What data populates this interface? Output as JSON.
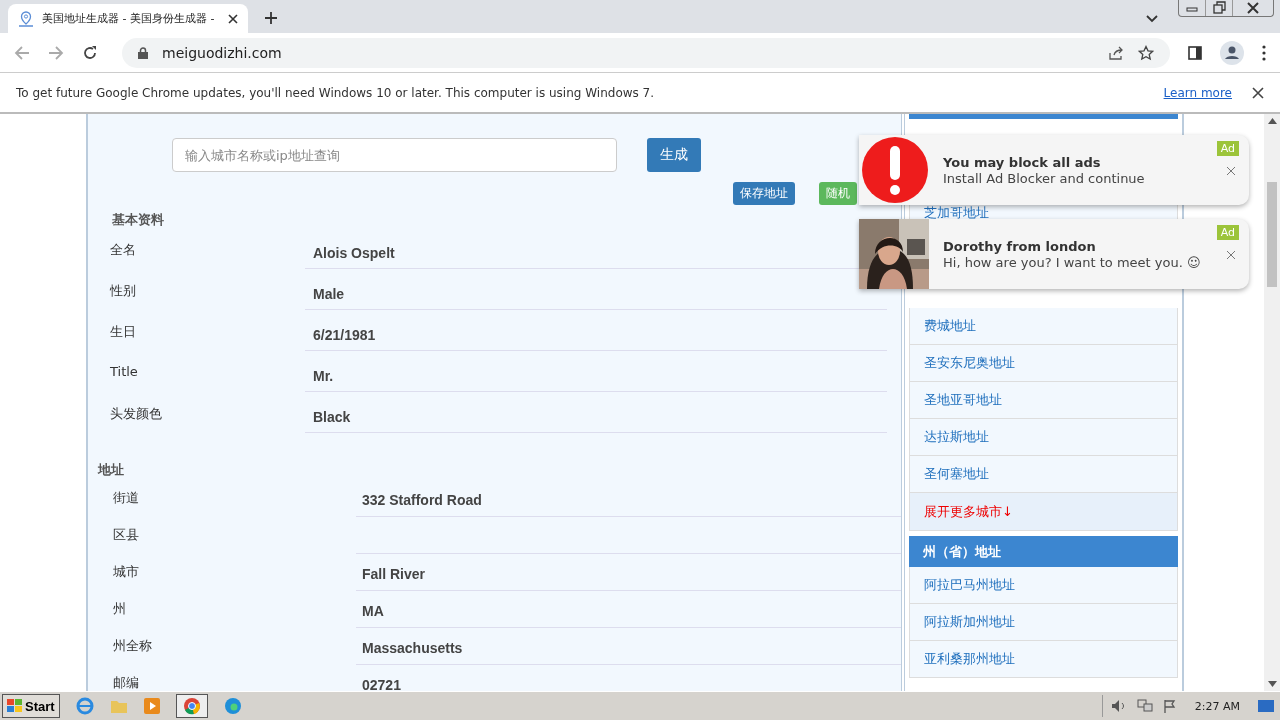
{
  "browser": {
    "tab_title": "美国地址生成器 - 美国身份生成器 -",
    "url": "meiguodizhi.com",
    "infobar": {
      "message": "To get future Google Chrome updates, you'll need Windows 10 or later. This computer is using Windows 7.",
      "link": "Learn more"
    }
  },
  "search": {
    "placeholder": "输入城市名称或ip地址查询",
    "button": "生成"
  },
  "actions": [
    {
      "label": "保存地址",
      "kind": "primary"
    },
    {
      "label": "随机",
      "kind": "success"
    }
  ],
  "basic": {
    "heading": "基本资料",
    "rows": [
      {
        "label": "全名",
        "value": "Alois Ospelt"
      },
      {
        "label": "性别",
        "value": "Male"
      },
      {
        "label": "生日",
        "value": "6/21/1981"
      },
      {
        "label": "Title",
        "value": "Mr."
      },
      {
        "label": "头发颜色",
        "value": "Black"
      }
    ]
  },
  "address": {
    "heading": "地址",
    "rows": [
      {
        "label": "街道",
        "value": "332 Stafford Road"
      },
      {
        "label": "区县"
      },
      {
        "label": "城市",
        "value": "Fall River"
      },
      {
        "label": "州",
        "value": "MA"
      },
      {
        "label": "州全称",
        "value": "Massachusetts"
      },
      {
        "label": "邮编",
        "value": "02721"
      }
    ]
  },
  "sidebar": {
    "cities": [
      {
        "label": "芝加哥地址",
        "kind": "link"
      },
      {
        "label": "费城地址",
        "kind": "link"
      },
      {
        "label": "圣安东尼奥地址",
        "kind": "link"
      },
      {
        "label": "圣地亚哥地址",
        "kind": "link"
      },
      {
        "label": "达拉斯地址",
        "kind": "link"
      },
      {
        "label": "圣何塞地址",
        "kind": "link"
      },
      {
        "label": "展开更多城市↓",
        "kind": "more"
      }
    ],
    "states_heading": "州（省）地址",
    "states": [
      "阿拉巴马州地址",
      "阿拉斯加州地址",
      "亚利桑那州地址"
    ]
  },
  "ads": [
    {
      "kind": "alert",
      "title": "You may block all ads",
      "text": "Install Ad Blocker and continue",
      "badge": "Ad"
    },
    {
      "title": "Dorothy from london",
      "text": "Hi, how are you? I want to meet you. ☺",
      "badge": "Ad"
    }
  ],
  "taskbar": {
    "start": "Start",
    "time": "2:27 AM"
  }
}
